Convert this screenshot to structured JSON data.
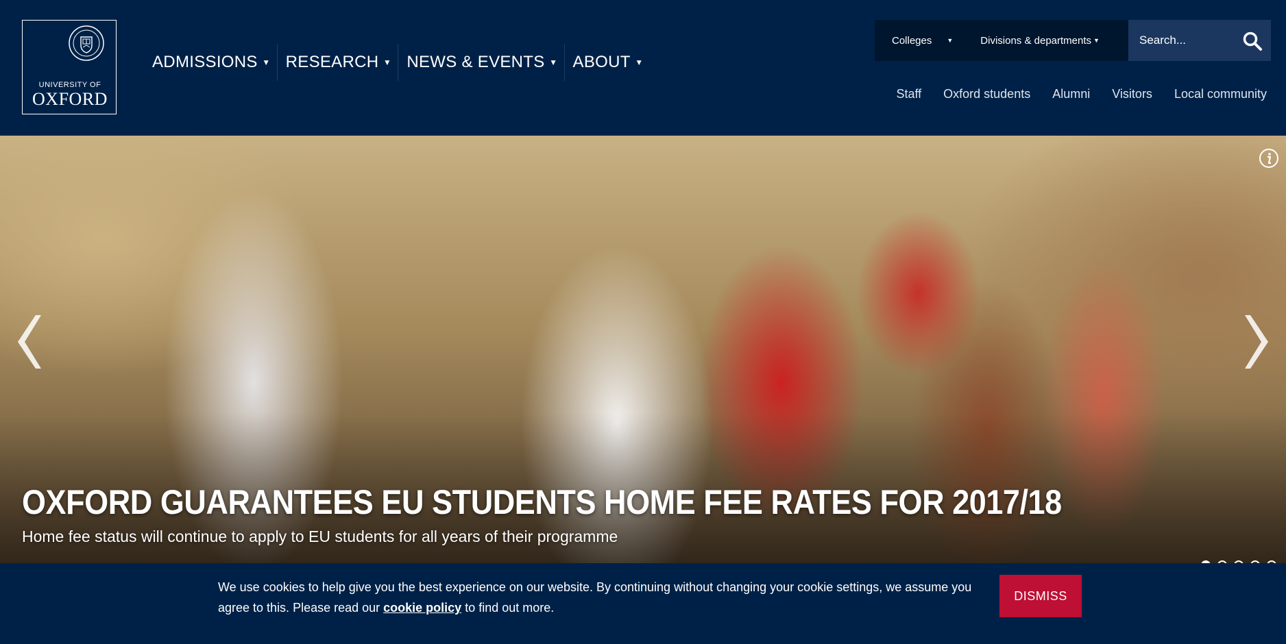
{
  "logo": {
    "line1": "UNIVERSITY OF",
    "line2": "OXFORD"
  },
  "main_nav": [
    {
      "label": "ADMISSIONS"
    },
    {
      "label": "RESEARCH"
    },
    {
      "label": "NEWS & EVENTS"
    },
    {
      "label": "ABOUT"
    }
  ],
  "utility": {
    "colleges": "Colleges",
    "divisions": "Divisions & departments",
    "search_placeholder": "Search..."
  },
  "audience_links": [
    "Staff",
    "Oxford students",
    "Alumni",
    "Visitors",
    "Local community"
  ],
  "hero": {
    "title": "OXFORD GUARANTEES EU STUDENTS HOME FEE RATES FOR 2017/18",
    "subtitle": "Home fee status will continue to apply to EU students for all years of their programme",
    "slide_count": 5,
    "active_slide": 1
  },
  "cookie": {
    "text_before": "We use cookies to help give you the best experience on our website. By continuing without changing your cookie settings, we assume you agree to this. Please read our ",
    "link": "cookie policy",
    "text_after": " to find out more.",
    "dismiss": "DISMISS"
  },
  "colors": {
    "navy": "#002147",
    "dark_navy": "#00152e",
    "search_bg": "#1b3760",
    "dismiss_red": "#be0f34"
  }
}
